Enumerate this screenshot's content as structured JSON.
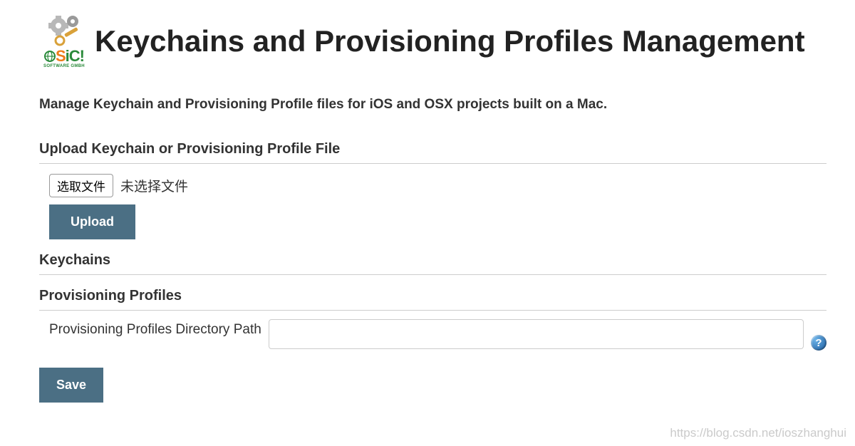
{
  "header": {
    "title": "Keychains and Provisioning Profiles Management",
    "logo_text_main": "SiC!",
    "logo_text_sub": "SOFTWARE GMBH"
  },
  "description": "Manage Keychain and Provisioning Profile files for iOS and OSX projects built on a Mac.",
  "upload": {
    "section_title": "Upload Keychain or Provisioning Profile File",
    "choose_label": "选取文件",
    "status_label": "未选择文件",
    "upload_button": "Upload"
  },
  "keychains": {
    "section_title": "Keychains"
  },
  "profiles": {
    "section_title": "Provisioning Profiles",
    "path_label": "Provisioning Profiles Directory Path",
    "path_value": ""
  },
  "actions": {
    "save_label": "Save"
  },
  "watermark": "https://blog.csdn.net/ioszhanghui"
}
